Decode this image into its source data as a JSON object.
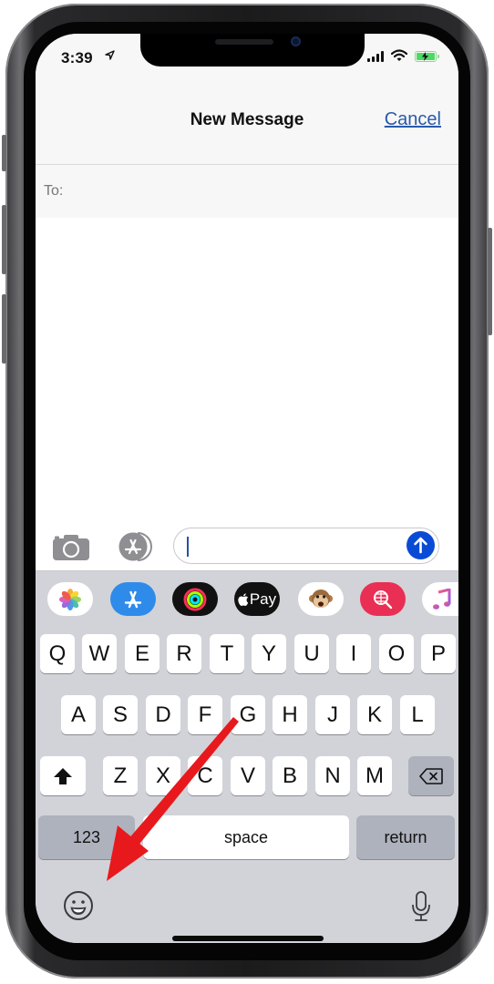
{
  "status_bar": {
    "time": "3:39",
    "location_icon": "location-arrow-icon",
    "signal_icon": "cellular-signal-icon",
    "wifi_icon": "wifi-icon",
    "battery_icon": "battery-charging-icon",
    "battery_color": "#4cd964"
  },
  "nav": {
    "title": "New Message",
    "cancel_label": "Cancel",
    "accent_color": "#2a5aa8"
  },
  "recipient": {
    "label": "To:",
    "value": ""
  },
  "compose": {
    "camera_icon": "camera-icon",
    "apps_icon": "app-store-icon",
    "message_value": "",
    "send_icon": "arrow-up-icon",
    "send_color": "#0a4bd6"
  },
  "app_drawer": [
    {
      "name": "photos",
      "icon": "photos-flower-icon",
      "bg": "#ffffff"
    },
    {
      "name": "app-store",
      "icon": "app-store-icon",
      "bg": "#2f8bea"
    },
    {
      "name": "activity",
      "icon": "activity-rings-icon",
      "bg": "#111111"
    },
    {
      "name": "apple-pay",
      "label": "Pay",
      "icon": "apple-logo-icon",
      "bg": "#111111"
    },
    {
      "name": "animoji",
      "icon": "monkey-face-icon",
      "bg": "#ffffff"
    },
    {
      "name": "images-search",
      "icon": "globe-search-icon",
      "bg": "#ea2f55"
    },
    {
      "name": "music",
      "icon": "music-note-icon",
      "bg": "#ffffff"
    }
  ],
  "keyboard": {
    "row1": [
      "Q",
      "W",
      "E",
      "R",
      "T",
      "Y",
      "U",
      "I",
      "O",
      "P"
    ],
    "row2": [
      "A",
      "S",
      "D",
      "F",
      "G",
      "H",
      "J",
      "K",
      "L"
    ],
    "row3": [
      "Z",
      "X",
      "C",
      "V",
      "B",
      "N",
      "M"
    ],
    "shift_icon": "shift-arrow-icon",
    "delete_icon": "backspace-icon",
    "numbers_label": "123",
    "space_label": "space",
    "return_label": "return",
    "emoji_icon": "emoji-smiley-icon",
    "mic_icon": "microphone-icon"
  },
  "annotation": {
    "type": "arrow",
    "color": "#e8191c",
    "points_to": "emoji-button"
  }
}
